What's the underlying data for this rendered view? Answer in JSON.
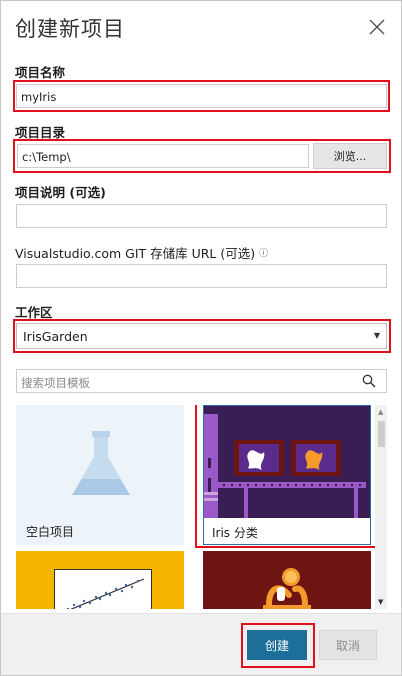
{
  "dialog": {
    "title": "创建新项目"
  },
  "project_name": {
    "label": "项目名称",
    "value": "myIris"
  },
  "project_dir": {
    "label": "项目目录",
    "value": "c:\\Temp\\",
    "browse_label": "浏览..."
  },
  "project_desc": {
    "label": "项目说明 (可选)",
    "value": ""
  },
  "git_repo": {
    "label": "Visualstudio.com GIT 存储库 URL (可选)",
    "info_icon": "ⓘ",
    "value": ""
  },
  "workspace": {
    "label": "工作区",
    "selected": "IrisGarden"
  },
  "template_search": {
    "placeholder": "搜索项目模板"
  },
  "templates": [
    {
      "label": "空白项目",
      "icon": "flask-icon"
    },
    {
      "label": "Iris 分类",
      "icon": "iris-pipeline-icon"
    },
    {
      "label": "",
      "icon": "scatter-chart-icon"
    },
    {
      "label": "",
      "icon": "hand-coin-icon"
    }
  ],
  "footer": {
    "create_label": "创建",
    "cancel_label": "取消"
  },
  "colors": {
    "highlight": "#e2101c",
    "primary": "#1d6f9a",
    "iris_tile_bg": "#3b1d55",
    "blank_tile_bg": "#ecf3f9",
    "scatter_tile_bg": "#f7b500",
    "hand_tile_bg": "#6e1413"
  }
}
